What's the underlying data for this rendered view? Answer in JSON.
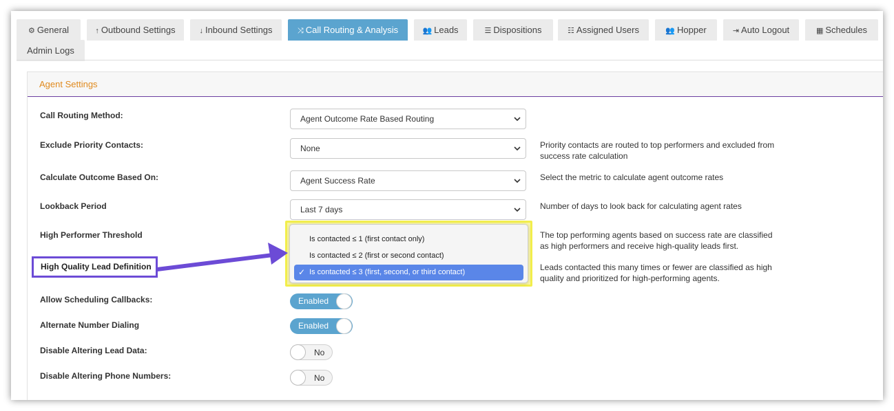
{
  "tabs": [
    {
      "label": "General",
      "icon": "gears-icon",
      "active": false
    },
    {
      "label": "Outbound Settings",
      "icon": "arrow-up-icon",
      "active": false
    },
    {
      "label": "Inbound Settings",
      "icon": "arrow-down-icon",
      "active": false
    },
    {
      "label": "Call Routing & Analysis",
      "icon": "shuffle-icon",
      "active": true
    },
    {
      "label": "Leads",
      "icon": "users-icon",
      "active": false
    },
    {
      "label": "Dispositions",
      "icon": "list-icon",
      "active": false
    },
    {
      "label": "Assigned Users",
      "icon": "numbered-list-icon",
      "active": false
    },
    {
      "label": "Hopper",
      "icon": "users-icon",
      "active": false
    },
    {
      "label": "Auto Logout",
      "icon": "sign-out-icon",
      "active": false
    },
    {
      "label": "Schedules",
      "icon": "calendar-icon",
      "active": false
    },
    {
      "label": "Admin Logs",
      "icon": "",
      "active": false
    }
  ],
  "panel": {
    "title": "Agent Settings"
  },
  "fields": {
    "routing_method": {
      "label": "Call Routing Method:",
      "value": "Agent Outcome Rate Based Routing"
    },
    "exclude_priority": {
      "label": "Exclude Priority Contacts:",
      "value": "None",
      "desc": "Priority contacts are routed to top performers and excluded from success rate calculation"
    },
    "outcome_based_on": {
      "label": "Calculate Outcome Based On:",
      "value": "Agent Success Rate",
      "desc": "Select the metric to calculate agent outcome rates"
    },
    "lookback": {
      "label": "Lookback Period",
      "value": "Last 7 days",
      "desc": "Number of days to look back for calculating agent rates"
    },
    "high_performer": {
      "label": "High Performer Threshold",
      "desc": "The top performing agents based on success rate are classified as high performers and receive high-quality leads first."
    },
    "high_quality": {
      "label": "High Quality Lead Definition",
      "desc": "Leads contacted this many times or fewer are classified as high quality and prioritized for high-performing agents."
    },
    "scheduling_callbacks": {
      "label": "Allow Scheduling Callbacks:",
      "state": "Enabled"
    },
    "alternate_dialing": {
      "label": "Alternate Number Dialing",
      "state": "Enabled"
    },
    "disable_lead_data": {
      "label": "Disable Altering Lead Data:",
      "state": "No"
    },
    "disable_phone_numbers": {
      "label": "Disable Altering Phone Numbers:",
      "state": "No"
    }
  },
  "dropdown": {
    "options": [
      "Is contacted ≤ 1 (first contact only)",
      "Is contacted ≤ 2 (first or second contact)",
      "Is contacted ≤ 3 (first, second, or third contact)"
    ],
    "selected_index": 2,
    "check_glyph": "✓"
  },
  "colors": {
    "accent": "#5ba4cf",
    "panel_title": "#e08a1e",
    "callout_border": "#6c4bd6",
    "highlight": "#f2ee4c",
    "selected_option": "#5a86e8"
  }
}
